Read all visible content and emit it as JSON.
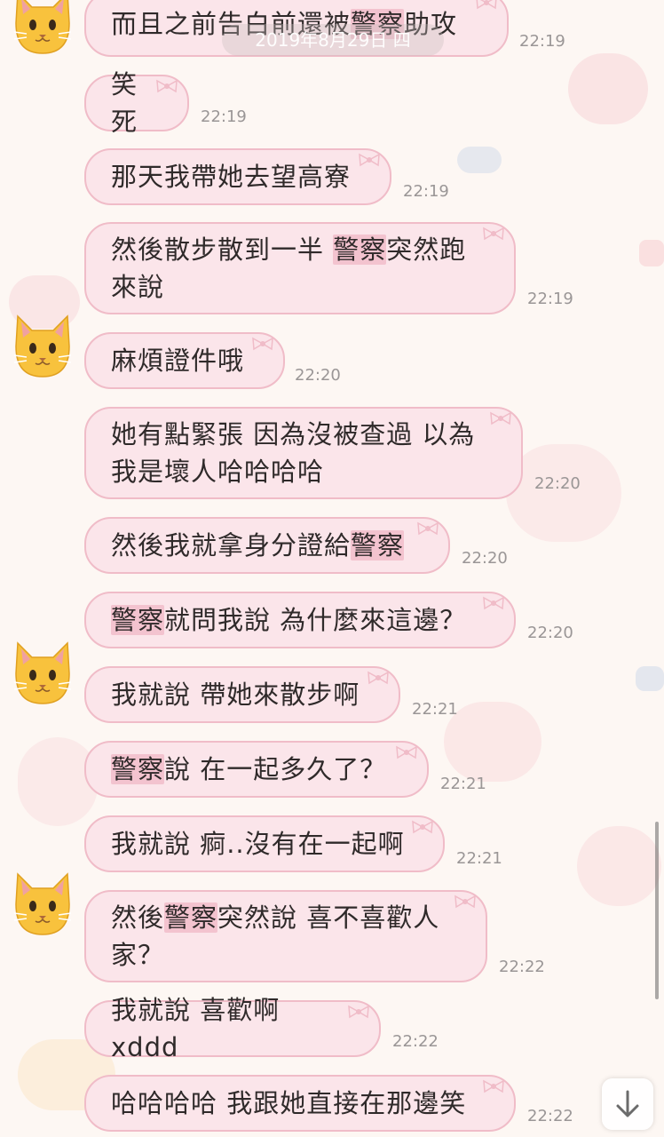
{
  "chat": {
    "date_label": "2019年8月29日 四",
    "highlight_term": "警察",
    "messages": [
      {
        "text": "而且之前告白前還被警察助攻",
        "time": "22:19"
      },
      {
        "text": "笑死",
        "time": "22:19"
      },
      {
        "text": "那天我帶她去望高寮",
        "time": "22:19"
      },
      {
        "text": "然後散步散到一半 警察突然跑\n來說",
        "time": "22:19"
      },
      {
        "text": "麻煩證件哦",
        "time": "22:20"
      },
      {
        "text": "她有點緊張 因為沒被查過 以為\n我是壞人哈哈哈哈",
        "time": "22:20"
      },
      {
        "text": "然後我就拿身分證給警察",
        "time": "22:20"
      },
      {
        "text": "警察就問我說 為什麼來這邊？",
        "time": "22:20"
      },
      {
        "text": "我就說 帶她來散步啊",
        "time": "22:21"
      },
      {
        "text": "警察說 在一起多久了？",
        "time": "22:21"
      },
      {
        "text": "我就說 痾..沒有在一起啊",
        "time": "22:21"
      },
      {
        "text": "然後警察突然說 喜不喜歡人\n家？",
        "time": "22:22"
      },
      {
        "text": "我就說 喜歡啊 xddd",
        "time": "22:22"
      },
      {
        "text": "哈哈哈哈 我跟她直接在那邊笑",
        "time": "22:22"
      }
    ]
  },
  "colors": {
    "bubble_fill": "#fbe5ea",
    "bubble_border": "#f0bcc8",
    "highlight": "#f3c3cf",
    "background": "#fdf7f3",
    "timestamp": "#9a9696"
  },
  "icons": {
    "avatar": "cat-face-emoji",
    "scroll_button": "arrow-down-icon"
  }
}
